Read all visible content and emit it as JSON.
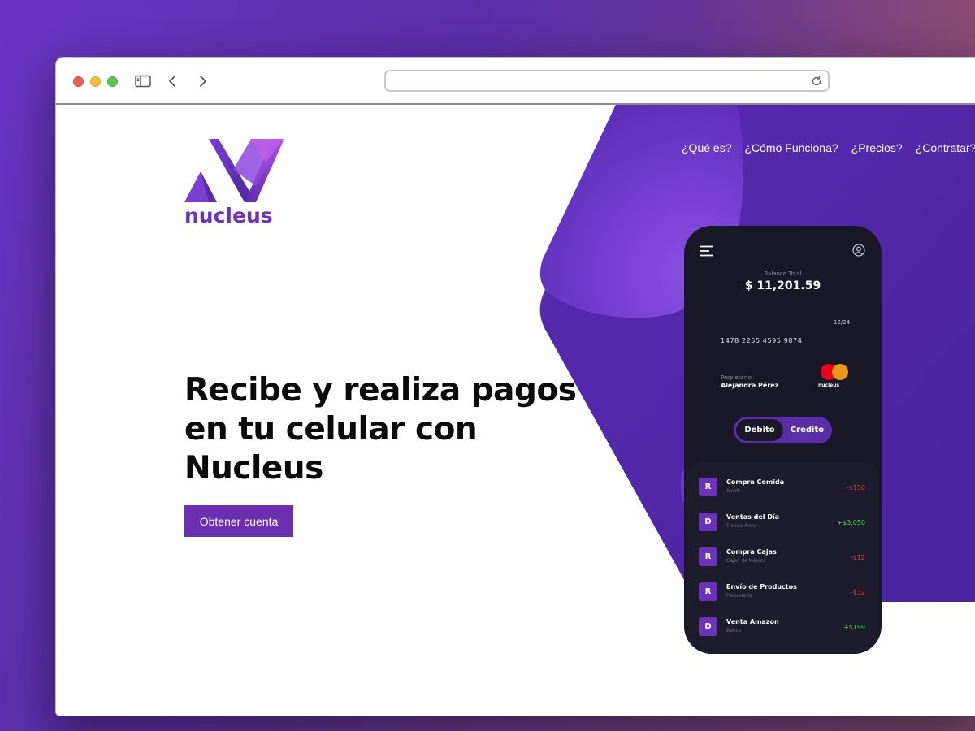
{
  "browser": {
    "address": ""
  },
  "brand": {
    "name": "nucleus",
    "color": "#6b34b8"
  },
  "nav": {
    "items": [
      "¿Qué es?",
      "¿Cómo Funciona?",
      "¿Precios?",
      "¿Contratar?"
    ]
  },
  "hero": {
    "headline_lines": [
      "Recibe y realiza pagos",
      "en tu celular con",
      "Nucleus"
    ],
    "cta_label": "Obtener cuenta",
    "accent": "#6b2fb0"
  },
  "phone": {
    "balance_label": "Balance Total",
    "balance_amount": "$ 11,201.59",
    "card": {
      "expiry": "12/24",
      "number": "1478 2255 4595 9874",
      "owner_label": "Propietario",
      "owner_name": "Alejandra Pérez",
      "brand_word": "nucleus"
    },
    "toggle": {
      "active": "Debito",
      "other": "Credito"
    },
    "transactions": [
      {
        "badge": "R",
        "title": "Compra Comida",
        "subtitle": "Avert",
        "amount": "-$150",
        "type": "neg"
      },
      {
        "badge": "D",
        "title": "Ventas del Día",
        "subtitle": "Tienda Anna",
        "amount": "+$3,050",
        "type": "pos"
      },
      {
        "badge": "R",
        "title": "Compra Cajas",
        "subtitle": "Cajas de México",
        "amount": "-$12",
        "type": "neg"
      },
      {
        "badge": "R",
        "title": "Envío de Productos",
        "subtitle": "Paquetería",
        "amount": "-$32",
        "type": "neg"
      },
      {
        "badge": "D",
        "title": "Venta Amazon",
        "subtitle": "Banco",
        "amount": "+$199",
        "type": "pos"
      }
    ]
  }
}
